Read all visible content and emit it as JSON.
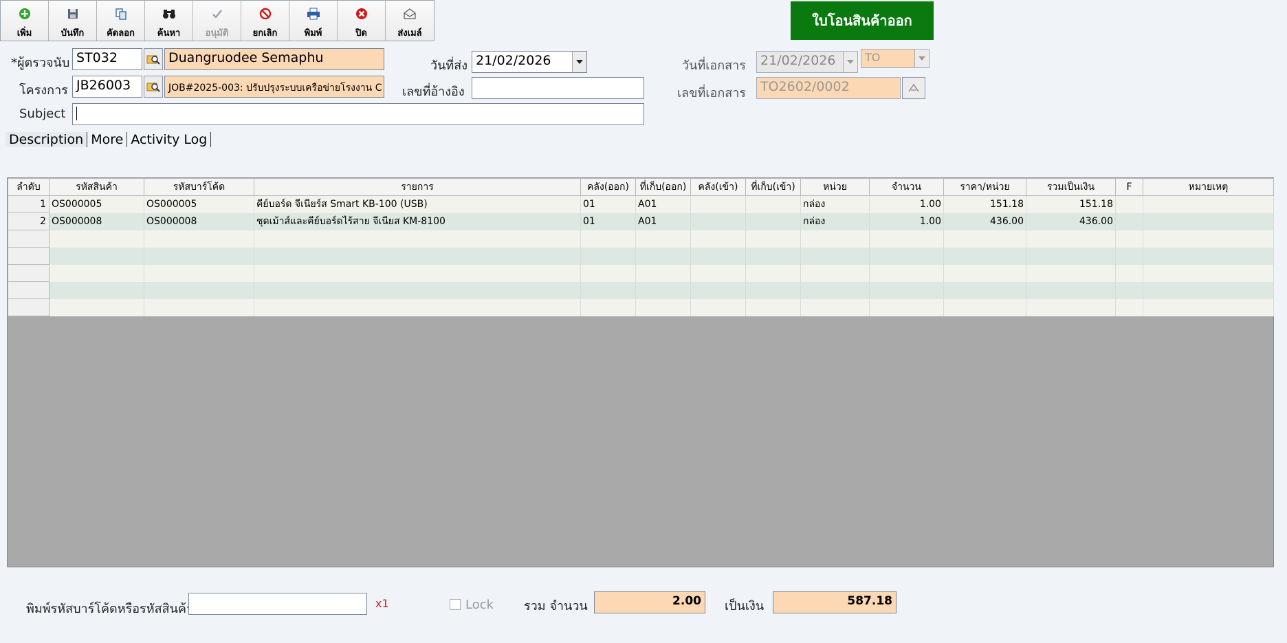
{
  "toolbar": {
    "buttons": [
      {
        "label": "เพิ่ม",
        "icon": "add-icon"
      },
      {
        "label": "บันทึก",
        "icon": "save-icon"
      },
      {
        "label": "คัดลอก",
        "icon": "copy-icon"
      },
      {
        "label": "ค้นหา",
        "icon": "binoculars-icon"
      },
      {
        "label": "อนุมัติ",
        "icon": "approve-icon"
      },
      {
        "label": "ยกเลิก",
        "icon": "cancel-icon"
      },
      {
        "label": "พิมพ์",
        "icon": "print-icon"
      },
      {
        "label": "ปิด",
        "icon": "close-icon"
      },
      {
        "label": "ส่งเมล์",
        "icon": "mail-icon"
      }
    ]
  },
  "document_title": "ใบโอนสินค้าออก",
  "header": {
    "inspector_label": "*ผู้ตรวจนับ",
    "inspector_code": "ST032",
    "inspector_name": "Duangruodee Semaphu",
    "project_label": "โครงการ",
    "project_code": "JB26003",
    "project_name": "JOB#2025-003: ปรับปรุงระบบเครือข่ายโรงงาน C",
    "subject_label": "Subject",
    "subject_value": "",
    "ship_date_label": "วันที่ส่ง",
    "ship_date": "21/02/2026",
    "ref_no_label": "เลขที่อ้างอิง",
    "ref_no": "",
    "doc_date_label": "วันที่เอกสาร",
    "doc_date": "21/02/2026",
    "doc_type": "TO",
    "doc_no_label": "เลขที่เอกสาร",
    "doc_no": "TO2602/0002"
  },
  "tabs": [
    "Description",
    "More",
    "Activity Log"
  ],
  "grid": {
    "columns": [
      "ลำดับ",
      "รหัสสินค้า",
      "รหัสบาร์โค้ด",
      "รายการ",
      "คลัง(ออก)",
      "ที่เก็บ(ออก)",
      "คลัง(เข้า)",
      "ที่เก็บ(เข้า)",
      "หน่วย",
      "จำนวน",
      "ราคา/หน่วย",
      "รวมเป็นเงิน",
      "F",
      "หมายเหตุ"
    ],
    "rows": [
      [
        "1",
        "OS000005",
        "OS000005",
        "คีย์บอร์ด จีเนียร์ส Smart KB-100 (USB)",
        "01",
        "A01",
        "",
        "",
        "กล่อง",
        "1.00",
        "151.18",
        "151.18",
        "",
        ""
      ],
      [
        "2",
        "OS000008",
        "OS000008",
        "ชุดเม้าส์และคีย์บอร์ดไร้สาย จีเนียส KM-8100",
        "01",
        "A01",
        "",
        "",
        "กล่อง",
        "1.00",
        "436.00",
        "436.00",
        "",
        ""
      ]
    ],
    "empty_rows": 5
  },
  "footer": {
    "barcode_label": "พิมพ์รหัสบาร์โค้ดหรือรหัสสินค้า",
    "barcode_value": "",
    "multiplier": "x1",
    "lock_label": "Lock",
    "total_qty_label": "รวม จำนวน",
    "total_qty": "2.00",
    "total_amount_label": "เป็นเงิน",
    "total_amount": "587.18"
  }
}
